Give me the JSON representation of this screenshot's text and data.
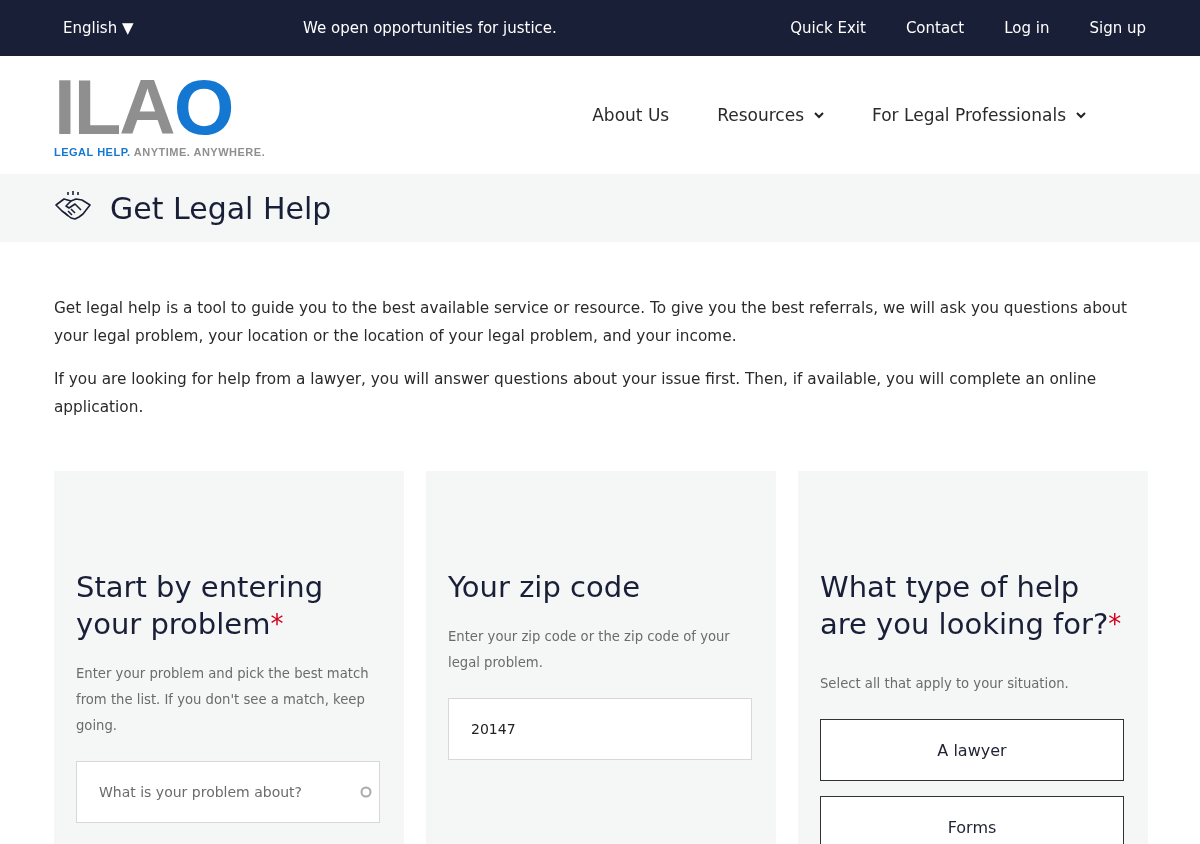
{
  "top_bar": {
    "language": "English ▼",
    "tagline": "We open opportunities for justice.",
    "links": [
      "Quick Exit",
      "Contact",
      "Log in",
      "Sign up"
    ]
  },
  "header": {
    "logo": {
      "letters": "ILAO",
      "tagline_primary": "LEGAL HELP.",
      "tagline_secondary": "ANYTIME. ANYWHERE."
    },
    "nav": [
      {
        "label": "About Us",
        "dropdown": false
      },
      {
        "label": "Resources",
        "dropdown": true
      },
      {
        "label": "For Legal Professionals",
        "dropdown": true
      }
    ]
  },
  "banner": {
    "title": "Get Legal Help"
  },
  "intro": [
    "Get legal help is a tool to guide you to the best available service or resource. To give you the best referrals, we will ask you questions about your legal problem, your location or the location of your legal problem, and your income.",
    "If you are looking for help from a lawyer, you will answer questions about your issue first. Then, if available, you will complete an online application."
  ],
  "cards": [
    {
      "kind": "search",
      "title": "Start by entering your problem",
      "required_mark": "*",
      "description": "Enter your problem and pick the best match from the list. If you don't see a match, keep going.",
      "placeholder": "What is your problem about?"
    },
    {
      "kind": "text",
      "title": "Your zip code",
      "description": "Enter your zip code or the zip code of your legal problem.",
      "value": "20147"
    },
    {
      "kind": "choices",
      "title": "What type of help are you looking for?",
      "required_mark": "*",
      "description": "Select all that apply to your situation.",
      "options": [
        {
          "label": "A lawyer",
          "selected": false
        },
        {
          "label": "Forms",
          "selected": false
        }
      ]
    }
  ]
}
